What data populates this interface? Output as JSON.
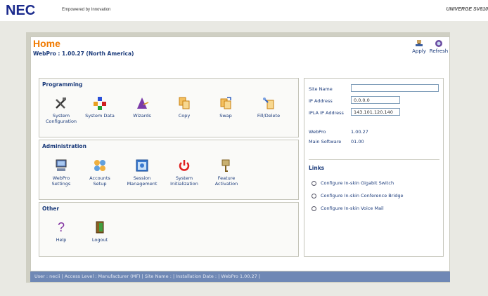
{
  "header": {
    "logo": "NEC",
    "tagline": "Empowered by Innovation",
    "brand_right": "UNIVERGE SV810"
  },
  "page": {
    "title": "Home",
    "subtitle": "WebPro : 1.00.27 (North America)"
  },
  "actions": {
    "apply": "Apply",
    "refresh": "Refresh"
  },
  "programming": {
    "title": "Programming",
    "items": [
      {
        "label1": "System",
        "label2": "Configuration",
        "icon": "tools-icon"
      },
      {
        "label1": "System Data",
        "label2": "",
        "icon": "system-data-icon"
      },
      {
        "label1": "Wizards",
        "label2": "",
        "icon": "wizard-icon"
      },
      {
        "label1": "Copy",
        "label2": "",
        "icon": "copy-icon"
      },
      {
        "label1": "Swap",
        "label2": "",
        "icon": "swap-icon"
      },
      {
        "label1": "Fill/Delete",
        "label2": "",
        "icon": "fill-delete-icon"
      }
    ]
  },
  "administration": {
    "title": "Administration",
    "items": [
      {
        "label1": "WebPro",
        "label2": "Settings",
        "icon": "webpro-settings-icon"
      },
      {
        "label1": "Accounts",
        "label2": "Setup",
        "icon": "accounts-icon"
      },
      {
        "label1": "Session",
        "label2": "Management",
        "icon": "session-icon"
      },
      {
        "label1": "System",
        "label2": "Initialization",
        "icon": "power-icon"
      },
      {
        "label1": "Feature",
        "label2": "Activation",
        "icon": "key-icon"
      }
    ]
  },
  "other": {
    "title": "Other",
    "items": [
      {
        "label1": "Help",
        "label2": "",
        "icon": "help-icon"
      },
      {
        "label1": "Logout",
        "label2": "",
        "icon": "logout-icon"
      }
    ]
  },
  "site": {
    "site_name_label": "Site Name",
    "site_name_value": "",
    "ip_label": "IP Address",
    "ip_value": "0.0.0.0",
    "ipla_label": "IPLA IP Address",
    "ipla_value": "143.101.120.140",
    "webpro_label": "WebPro",
    "webpro_value": "1.00.27",
    "main_sw_label": "Main Software",
    "main_sw_value": "01.00"
  },
  "links": {
    "title": "Links",
    "items": [
      "Configure In-skin Gigabit Switch",
      "Configure In-skin Conference Bridge",
      "Configure In-skin Voice Mail"
    ]
  },
  "status": {
    "text": "User : necii | Access Level : Manufacturer (MF) | Site Name : | Installation Date : | WebPro 1.00.27 |"
  },
  "colors": {
    "accent_orange": "#f07a00",
    "link_blue": "#1a3a7a",
    "statusbar": "#6f88b5",
    "background": "#e9e9e3"
  }
}
